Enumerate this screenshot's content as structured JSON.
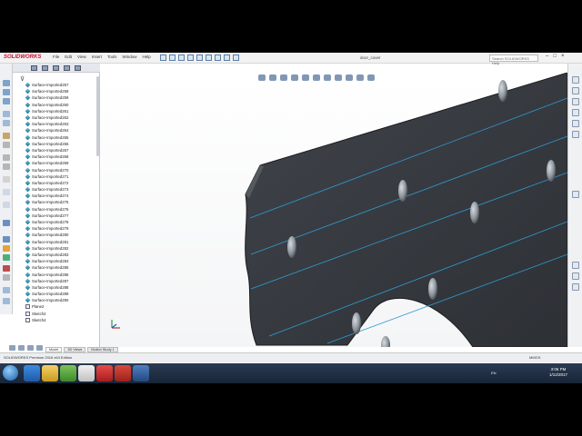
{
  "app": {
    "logo_text": "SOLIDWORKS",
    "menu": [
      "File",
      "Edit",
      "View",
      "Insert",
      "Tools",
      "Window",
      "Help"
    ],
    "document_title": "door_cover",
    "help_search_placeholder": "Search SOLIDWORKS Help",
    "window_controls": [
      "–",
      "□",
      "×"
    ]
  },
  "feature_tree": {
    "items": [
      "Surface-Imported257",
      "Surface-Imported258",
      "Surface-Imported259",
      "Surface-Imported260",
      "Surface-Imported261",
      "Surface-Imported262",
      "Surface-Imported263",
      "Surface-Imported264",
      "Surface-Imported265",
      "Surface-Imported266",
      "Surface-Imported267",
      "Surface-Imported268",
      "Surface-Imported269",
      "Surface-Imported270",
      "Surface-Imported271",
      "Surface-Imported272",
      "Surface-Imported273",
      "Surface-Imported274",
      "Surface-Imported275",
      "Surface-Imported276",
      "Surface-Imported277",
      "Surface-Imported278",
      "Surface-Imported279",
      "Surface-Imported280",
      "Surface-Imported281",
      "Surface-Imported282",
      "Surface-Imported283",
      "Surface-Imported284",
      "Surface-Imported285",
      "Surface-Imported286",
      "Surface-Imported287",
      "Surface-Imported288",
      "Surface-Imported289",
      "Surface-Imported290"
    ],
    "tail_items": [
      "Plane2",
      "Sketch2",
      "Sketch4"
    ]
  },
  "model_tabs": [
    "Model",
    "3D Views",
    "Motion Study 1"
  ],
  "status_bar": {
    "left": "SOLIDWORKS Premium 2016 x64 Edition",
    "units": "MMGS"
  },
  "taskbar": {
    "time": "3:06 PM",
    "date": "1/12/2017",
    "tray": "EN"
  },
  "colors": {
    "model_face": "#3a3d42",
    "model_edge": "#2f9cd0",
    "taskbar": "#1f2d42",
    "brand": "#c8102e"
  }
}
